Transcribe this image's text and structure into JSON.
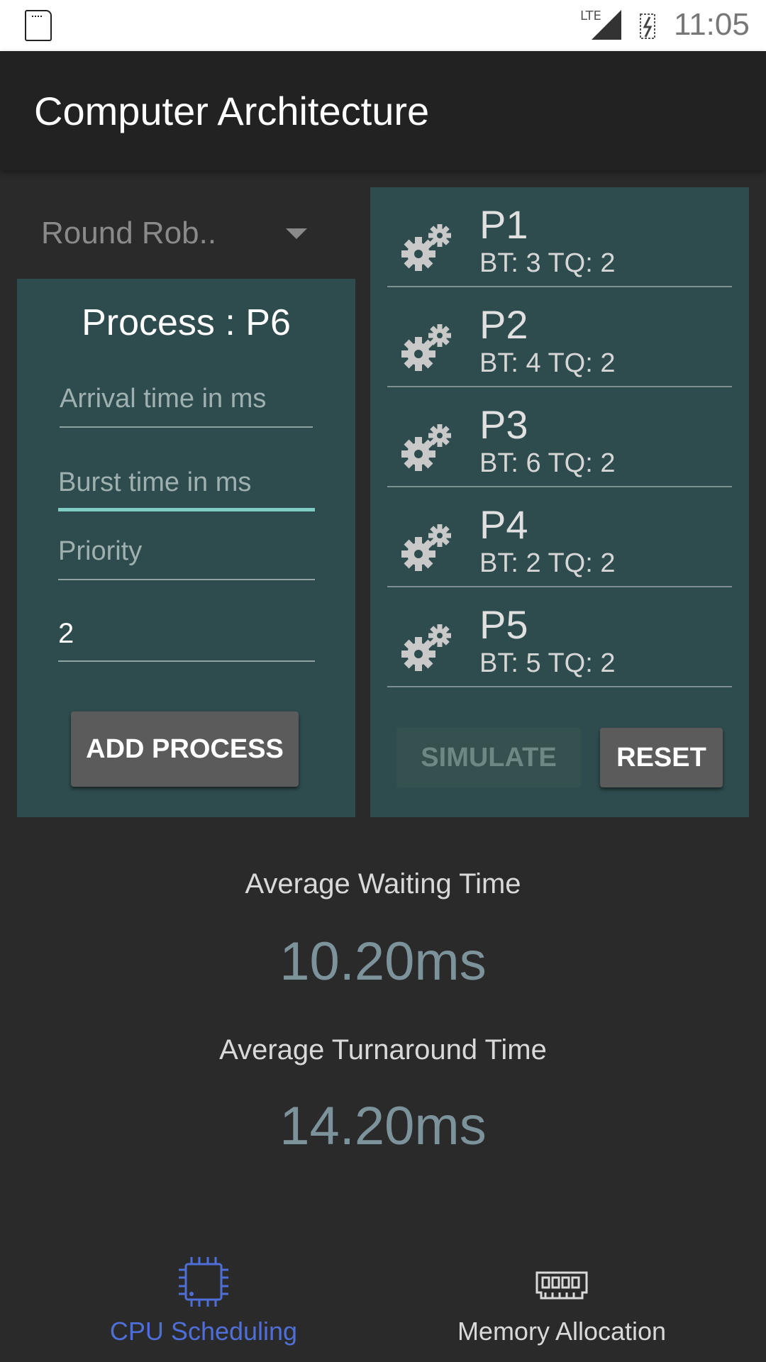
{
  "status_bar": {
    "network": "LTE",
    "time": "11:05",
    "icons": [
      "sd-card-icon",
      "signal-icon",
      "battery-charging-icon"
    ]
  },
  "app_bar": {
    "title": "Computer Architecture"
  },
  "algorithm_dropdown": {
    "selected": "Round Rob.."
  },
  "process_form": {
    "title": "Process : P6",
    "arrival_placeholder": "Arrival time in ms",
    "burst_placeholder": "Burst time in ms",
    "priority_placeholder": "Priority",
    "time_quantum_value": "2",
    "add_button": "ADD PROCESS"
  },
  "process_list": {
    "items": [
      {
        "name": "P1",
        "detail": "BT: 3 TQ: 2",
        "icon": "gears-icon"
      },
      {
        "name": "P2",
        "detail": "BT: 4 TQ: 2",
        "icon": "gears-icon"
      },
      {
        "name": "P3",
        "detail": "BT: 6 TQ: 2",
        "icon": "gears-icon"
      },
      {
        "name": "P4",
        "detail": "BT: 2 TQ: 2",
        "icon": "gears-icon"
      },
      {
        "name": "P5",
        "detail": "BT: 5 TQ: 2",
        "icon": "gears-icon"
      }
    ],
    "simulate_button": "SIMULATE",
    "reset_button": "RESET"
  },
  "results": {
    "avg_waiting_label": "Average Waiting Time",
    "avg_waiting_value": "10.20ms",
    "avg_turnaround_label": "Average Turnaround Time",
    "avg_turnaround_value": "14.20ms"
  },
  "bottom_nav": {
    "items": [
      {
        "label": "CPU Scheduling",
        "icon": "cpu-chip-icon",
        "active": true
      },
      {
        "label": "Memory Allocation",
        "icon": "memory-module-icon",
        "active": false
      }
    ]
  },
  "colors": {
    "panel": "#2e4b4d",
    "accent_focus": "#7fcdc4",
    "nav_active": "#4f6fd8",
    "nav_inactive": "#d9d9d9",
    "stat_value": "#7d939b"
  }
}
